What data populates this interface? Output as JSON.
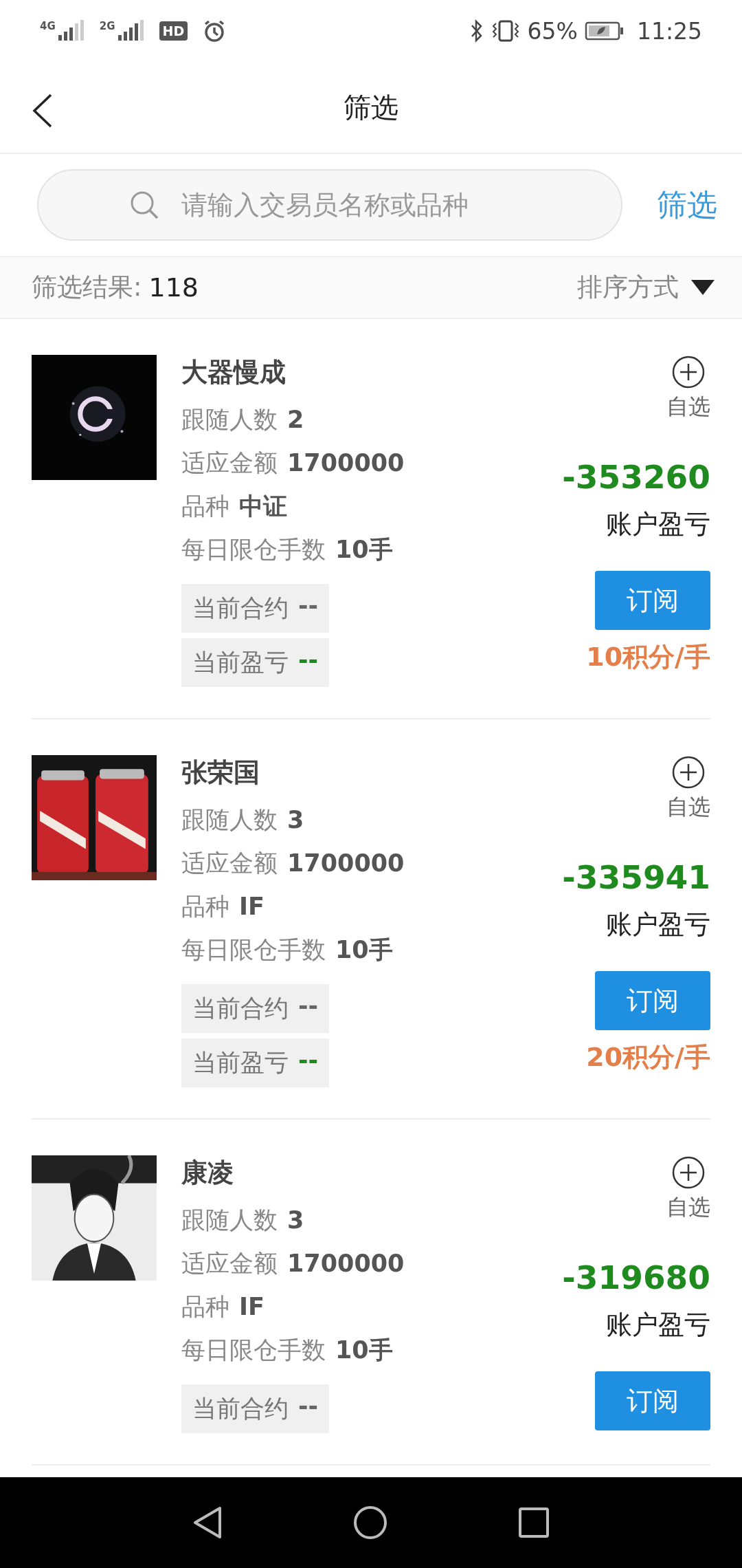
{
  "status_bar": {
    "sim1": "4G",
    "sim2": "2G",
    "hd": "HD",
    "battery": "65%",
    "time": "11:25"
  },
  "header": {
    "title": "筛选"
  },
  "search": {
    "placeholder": "请输入交易员名称或品种",
    "action": "筛选"
  },
  "result_bar": {
    "label": "筛选结果:",
    "count": "118",
    "sort": "排序方式"
  },
  "traders": [
    {
      "name": "大器慢成",
      "followers_label": "跟随人数",
      "followers": "2",
      "amount_label": "适应金额",
      "amount": "1700000",
      "product_label": "品种",
      "product": "中证",
      "limit_label": "每日限仓手数",
      "limit": "10手",
      "contract_label": "当前合约",
      "contract": "--",
      "pnl_label": "当前盈亏",
      "pnl": "--",
      "watch": "自选",
      "account_pnl": "-353260",
      "account_pnl_label": "账户盈亏",
      "subscribe": "订阅",
      "points": "10积分/手"
    },
    {
      "name": "张荣国",
      "followers_label": "跟随人数",
      "followers": "3",
      "amount_label": "适应金额",
      "amount": "1700000",
      "product_label": "品种",
      "product": "IF",
      "limit_label": "每日限仓手数",
      "limit": "10手",
      "contract_label": "当前合约",
      "contract": "--",
      "pnl_label": "当前盈亏",
      "pnl": "--",
      "watch": "自选",
      "account_pnl": "-335941",
      "account_pnl_label": "账户盈亏",
      "subscribe": "订阅",
      "points": "20积分/手"
    },
    {
      "name": "康凌",
      "followers_label": "跟随人数",
      "followers": "3",
      "amount_label": "适应金额",
      "amount": "1700000",
      "product_label": "品种",
      "product": "IF",
      "limit_label": "每日限仓手数",
      "limit": "10手",
      "contract_label": "当前合约",
      "contract": "--",
      "watch": "自选",
      "account_pnl": "-319680",
      "account_pnl_label": "账户盈亏",
      "subscribe": "订阅"
    }
  ]
}
